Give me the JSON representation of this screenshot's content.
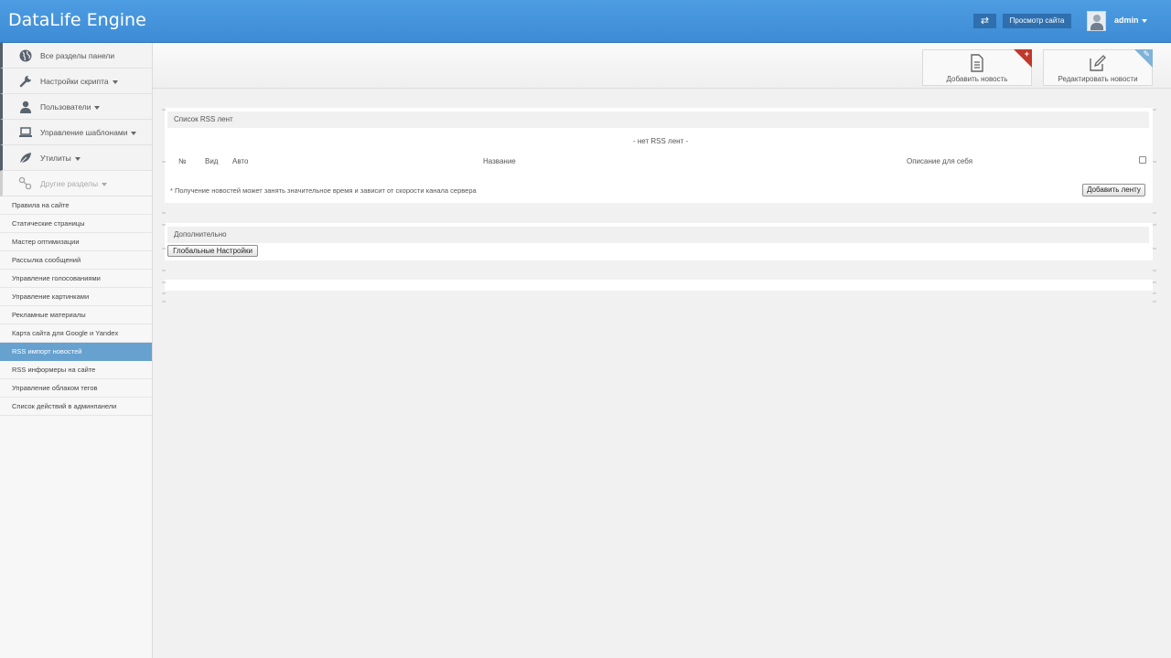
{
  "header": {
    "brand": "DataLife Engine",
    "swap_glyph": "⇄",
    "view_site": "Просмотр сайта",
    "user": "admin"
  },
  "sidebar": {
    "menu": [
      {
        "label": "Все разделы панели",
        "icon": "globe-icon",
        "caret": false
      },
      {
        "label": "Настройки скрипта",
        "icon": "wrench-icon",
        "caret": true
      },
      {
        "label": "Пользователи",
        "icon": "user-icon",
        "caret": true
      },
      {
        "label": "Управление шаблонами",
        "icon": "laptop-icon",
        "caret": true
      },
      {
        "label": "Утилиты",
        "icon": "leaf-icon",
        "caret": true
      },
      {
        "label": "Другие разделы",
        "icon": "share-icon",
        "caret": true
      }
    ],
    "subitems": [
      "Правила на сайте",
      "Статические страницы",
      "Мастер оптимизации",
      "Рассылка сообщений",
      "Управление голосованиями",
      "Управление картинками",
      "Рекламные материалы",
      "Карта сайта для Google и Yandex",
      "RSS импорт новостей",
      "RSS информеры на сайте",
      "Управление облаком тегов",
      "Список действий в админпанели"
    ],
    "active_subitem": "RSS импорт новостей"
  },
  "toolbar": {
    "add_news": "Добавить новость",
    "add_glyph": "+",
    "edit_news": "Редактировать новости",
    "edit_glyph": "✎"
  },
  "rss_panel": {
    "title": "Список RSS лент",
    "empty": "- нет RSS лент -",
    "columns": {
      "num": "№",
      "view": "Вид",
      "auto": "Авто",
      "name": "Название",
      "desc": "Описание для себя"
    },
    "note": "* Получение новостей может занять значительное время и зависит от скорости канала сервера",
    "add_button": "Добавить ленту"
  },
  "extra_panel": {
    "title": "Дополнительно",
    "global_button": "Глобальные Настройки"
  },
  "colors": {
    "header": "#4d9de3",
    "active": "#66a1cf",
    "red_corner": "#c0392b",
    "blue_corner": "#7fb2d8"
  }
}
